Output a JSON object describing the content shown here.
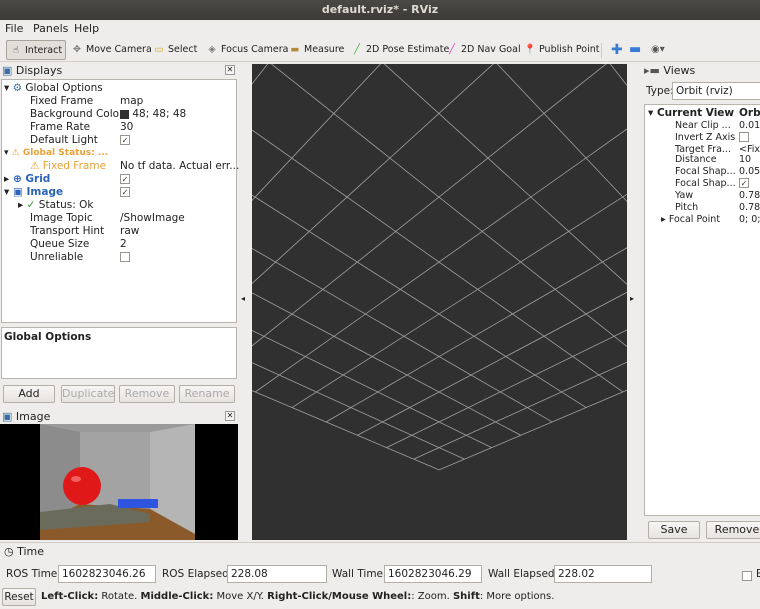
{
  "window": {
    "title": "default.rviz* - RViz"
  },
  "menu": {
    "file": "File",
    "panels": "Panels",
    "help": "Help"
  },
  "toolbar": {
    "interact": "Interact",
    "move_camera": "Move Camera",
    "select": "Select",
    "focus_camera": "Focus Camera",
    "measure": "Measure",
    "pose_estimate": "2D Pose Estimate",
    "nav_goal": "2D Nav Goal",
    "publish_point": "Publish Point"
  },
  "displays": {
    "title": "Displays",
    "global_options": "Global Options",
    "fixed_frame_label": "Fixed Frame",
    "fixed_frame_value": "map",
    "bg_color_label": "Background Color",
    "bg_color_value": "48; 48; 48",
    "frame_rate_label": "Frame Rate",
    "frame_rate_value": "30",
    "default_light_label": "Default Light",
    "global_status": "Global Status: ...",
    "status_fixed_frame_label": "Fixed Frame",
    "status_fixed_frame_value": "No tf data.  Actual err...",
    "grid_label": "Grid",
    "image_label": "Image",
    "status_ok": "Status: Ok",
    "image_topic_label": "Image Topic",
    "image_topic_value": "/ShowImage",
    "transport_hint_label": "Transport Hint",
    "transport_hint_value": "raw",
    "queue_size_label": "Queue Size",
    "queue_size_value": "2",
    "unreliable_label": "Unreliable",
    "description_title": "Global Options",
    "add": "Add",
    "duplicate": "Duplicate",
    "remove": "Remove",
    "rename": "Rename"
  },
  "image_panel": {
    "title": "Image"
  },
  "views": {
    "title": "Views",
    "type_label": "Type:",
    "type_value": "Orbit (rviz)",
    "current_view": "Current View",
    "current_view_value": "Orbi",
    "near_clip": "Near Clip ...",
    "near_clip_value": "0.01",
    "invert_z": "Invert Z Axis",
    "target_frame": "Target Fra...",
    "target_frame_value": "<Fix",
    "distance": "Distance",
    "distance_value": "10",
    "focal_shape1": "Focal Shap...",
    "focal_shape1_value": "0.05",
    "focal_shape2": "Focal Shap...",
    "yaw": "Yaw",
    "yaw_value": "0.78",
    "pitch": "Pitch",
    "pitch_value": "0.78",
    "focal_point": "Focal Point",
    "focal_point_value": "0; 0;",
    "save": "Save",
    "remove": "Remove"
  },
  "time": {
    "title": "Time",
    "ros_time_label": "ROS Time:",
    "ros_time_value": "1602823046.26",
    "ros_elapsed_label": "ROS Elapsed:",
    "ros_elapsed_value": "228.08",
    "wall_time_label": "Wall Time:",
    "wall_time_value": "1602823046.29",
    "wall_elapsed_label": "Wall Elapsed:",
    "wall_elapsed_value": "228.02",
    "exp_label": "E"
  },
  "status": {
    "reset": "Reset",
    "hint_left": "Left-Click:",
    "hint_left_text": " Rotate. ",
    "hint_middle": "Middle-Click:",
    "hint_middle_text": " Move X/Y. ",
    "hint_right": "Right-Click/Mouse Wheel:",
    "hint_right_text": ": Zoom. ",
    "hint_shift": "Shift",
    "hint_shift_text": ": More options."
  },
  "colors": {
    "viewport_bg": "#303030",
    "grid_line": "#a0a0a0",
    "accent_orange": "#e8a13a",
    "link_blue": "#2a62b8"
  }
}
